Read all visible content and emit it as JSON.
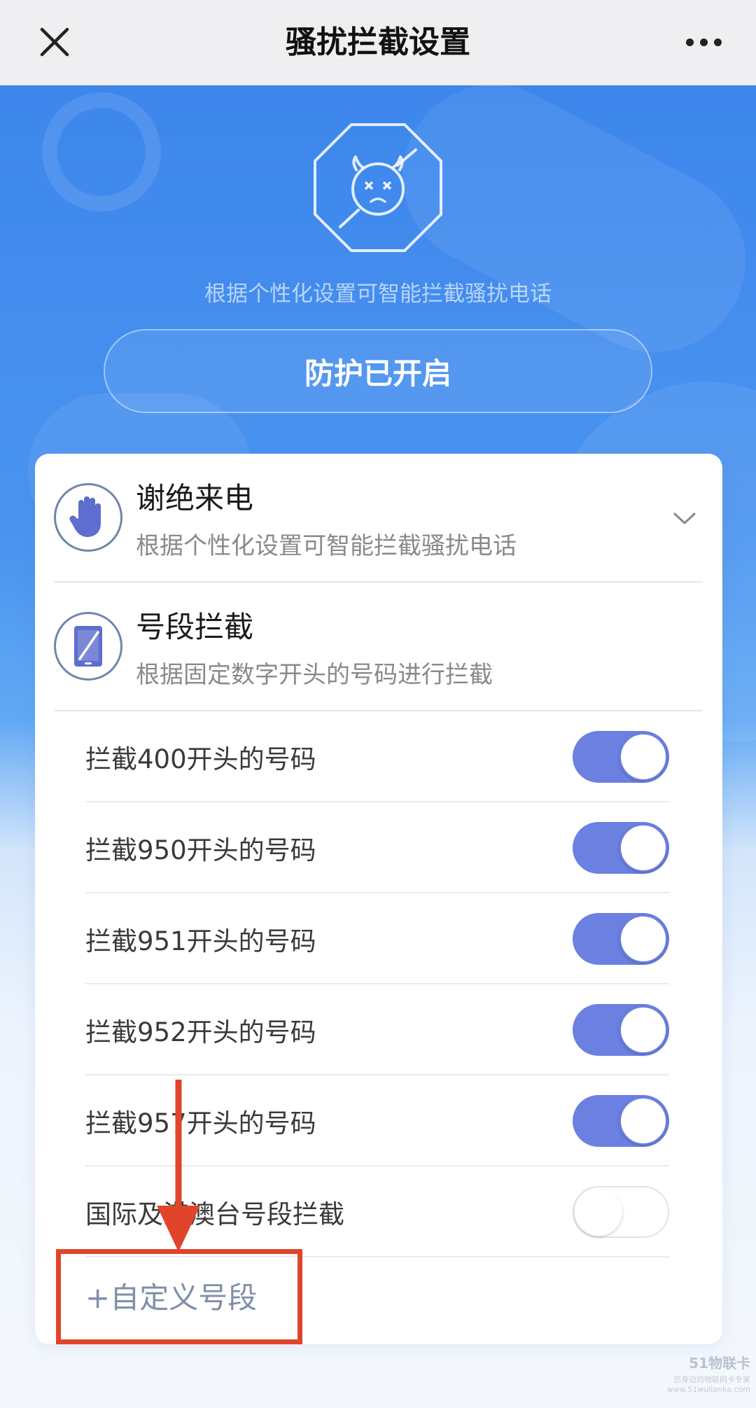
{
  "header": {
    "title": "骚扰拦截设置"
  },
  "hero": {
    "subtitle": "根据个性化设置可智能拦截骚扰电话",
    "protect_button": "防护已开启"
  },
  "sections": [
    {
      "title": "谢绝来电",
      "desc": "根据个性化设置可智能拦截骚扰电话",
      "icon": "hand-stop-icon",
      "expanded": false
    },
    {
      "title": "号段拦截",
      "desc": "根据固定数字开头的号码进行拦截",
      "icon": "phone-slash-icon"
    }
  ],
  "rules": [
    {
      "label": "拦截400开头的号码",
      "enabled": true
    },
    {
      "label": "拦截950开头的号码",
      "enabled": true
    },
    {
      "label": "拦截951开头的号码",
      "enabled": true
    },
    {
      "label": "拦截952开头的号码",
      "enabled": true
    },
    {
      "label": "拦截957开头的号码",
      "enabled": true
    },
    {
      "label": "国际及港澳台号段拦截",
      "enabled": false
    }
  ],
  "custom_segment": "+自定义号段",
  "watermark": {
    "brand": "51物联卡",
    "slogan": "您身边的物联网卡专家",
    "url": "www.51wulianka.com"
  },
  "colors": {
    "accent": "#6b80e0",
    "hero_blue": "#3d86ec",
    "annotation_red": "#e0452b"
  }
}
